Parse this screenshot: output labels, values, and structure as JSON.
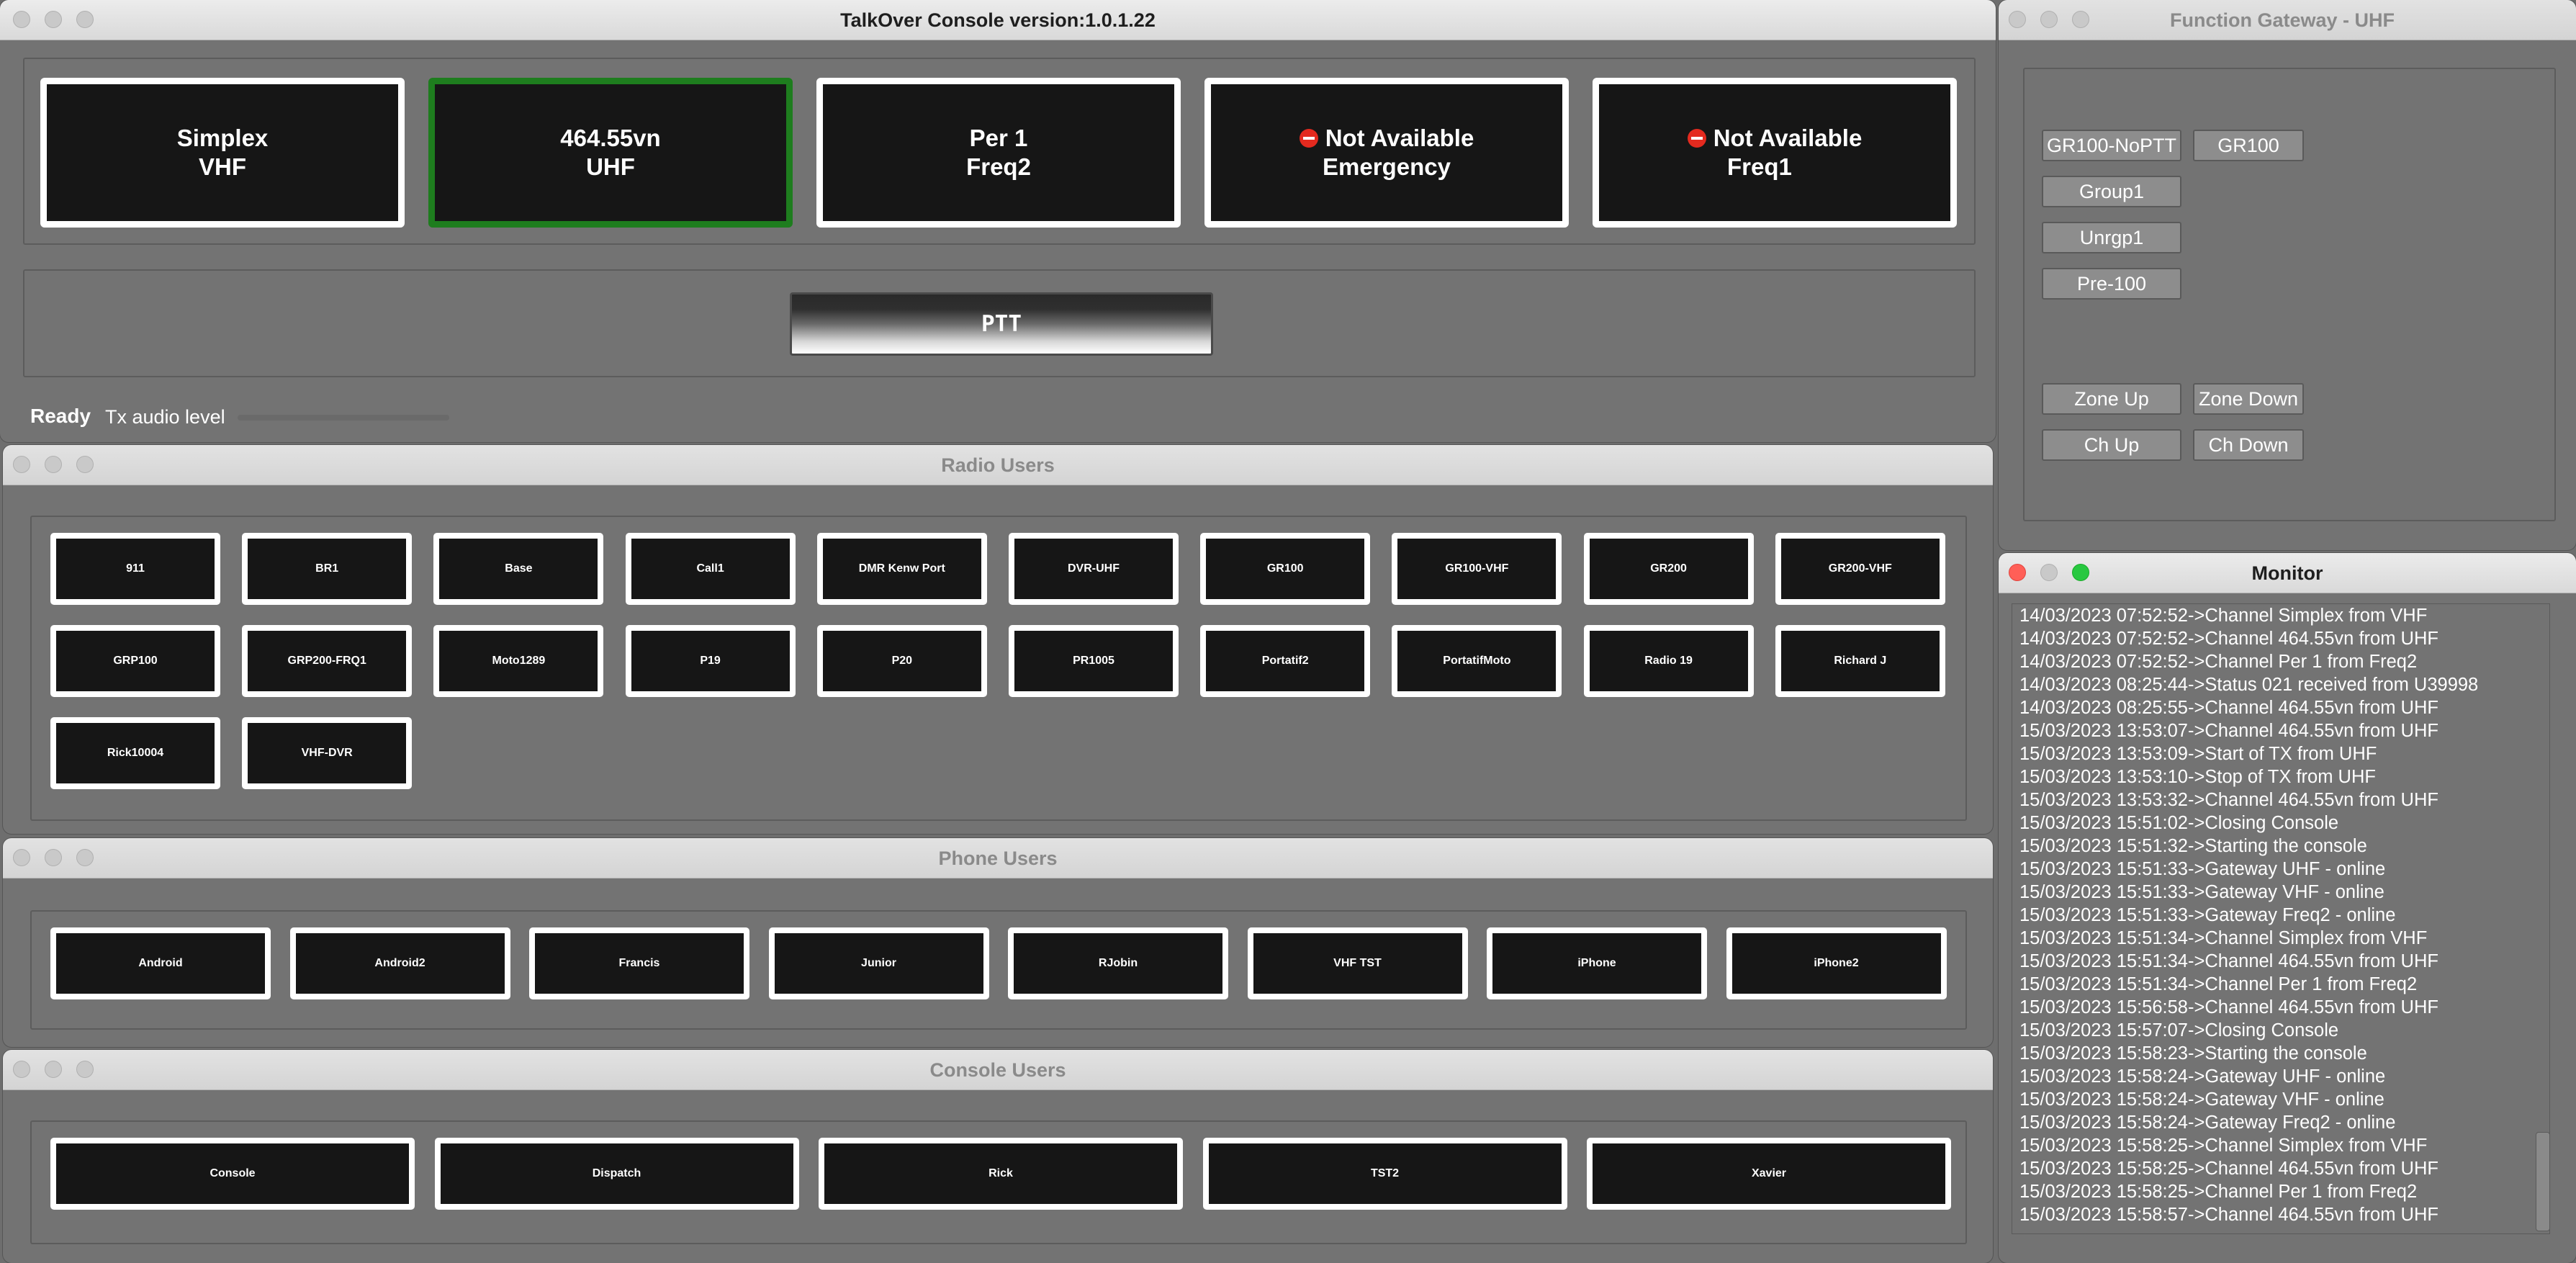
{
  "console_window": {
    "title": "TalkOver Console version:1.0.1.22",
    "channels": [
      {
        "line1": "Simplex",
        "line2": "VHF",
        "unavailable": false,
        "active": false
      },
      {
        "line1": "464.55vn",
        "line2": "UHF",
        "unavailable": false,
        "active": true
      },
      {
        "line1": "Per 1",
        "line2": "Freq2",
        "unavailable": false,
        "active": false
      },
      {
        "line1": "Not Available",
        "line2": "Emergency",
        "unavailable": true,
        "active": false
      },
      {
        "line1": "Not Available",
        "line2": "Freq1",
        "unavailable": true,
        "active": false
      }
    ],
    "ptt_label": "PTT",
    "status": "Ready",
    "tx_audio_label": "Tx audio level",
    "tx_audio_level": 0
  },
  "radio_users": {
    "title": "Radio Users",
    "users": [
      "911",
      "BR1",
      "Base",
      "Call1",
      "DMR Kenw Port",
      "DVR-UHF",
      "GR100",
      "GR100-VHF",
      "GR200",
      "GR200-VHF",
      "GRP100",
      "GRP200-FRQ1",
      "Moto1289",
      "P19",
      "P20",
      "PR1005",
      "Portatif2",
      "PortatifMoto",
      "Radio 19",
      "Richard J",
      "Rick10004",
      "VHF-DVR"
    ]
  },
  "phone_users": {
    "title": "Phone Users",
    "users": [
      "Android",
      "Android2",
      "Francis",
      "Junior",
      "RJobin",
      "VHF TST",
      "iPhone",
      "iPhone2"
    ]
  },
  "console_users": {
    "title": "Console Users",
    "users": [
      "Console",
      "Dispatch",
      "Rick",
      "TST2",
      "Xavier"
    ]
  },
  "function_gateway": {
    "title": "Function Gateway - UHF",
    "group_buttons": [
      "GR100-NoPTT",
      "GR100",
      "Group1",
      "Unrgp1",
      "Pre-100"
    ],
    "nav_buttons": [
      "Zone Up",
      "Zone Down",
      "Ch Up",
      "Ch Down"
    ]
  },
  "monitor": {
    "title": "Monitor",
    "lines": [
      "14/03/2023 07:52:52->Channel Simplex from VHF",
      "14/03/2023 07:52:52->Channel 464.55vn from UHF",
      "14/03/2023 07:52:52->Channel Per 1 from Freq2",
      "14/03/2023 08:25:44->Status 021 received from U39998",
      "14/03/2023 08:25:55->Channel 464.55vn from UHF",
      "15/03/2023 13:53:07->Channel 464.55vn from UHF",
      "15/03/2023 13:53:09->Start of TX from UHF",
      "15/03/2023 13:53:10->Stop of TX from UHF",
      "15/03/2023 13:53:32->Channel 464.55vn from UHF",
      "15/03/2023 15:51:02->Closing Console",
      "15/03/2023 15:51:32->Starting the console",
      "15/03/2023 15:51:33->Gateway UHF - online",
      "15/03/2023 15:51:33->Gateway VHF - online",
      "15/03/2023 15:51:33->Gateway Freq2 - online",
      "15/03/2023 15:51:34->Channel Simplex from VHF",
      "15/03/2023 15:51:34->Channel 464.55vn from UHF",
      "15/03/2023 15:51:34->Channel Per 1 from Freq2",
      "15/03/2023 15:56:58->Channel 464.55vn from UHF",
      "15/03/2023 15:57:07->Closing Console",
      "15/03/2023 15:58:23->Starting the console",
      "15/03/2023 15:58:24->Gateway UHF - online",
      "15/03/2023 15:58:24->Gateway VHF - online",
      "15/03/2023 15:58:24->Gateway Freq2 - online",
      "15/03/2023 15:58:25->Channel Simplex from VHF",
      "15/03/2023 15:58:25->Channel 464.55vn from UHF",
      "15/03/2023 15:58:25->Channel Per 1 from Freq2",
      "15/03/2023 15:58:57->Channel 464.55vn from UHF"
    ]
  }
}
